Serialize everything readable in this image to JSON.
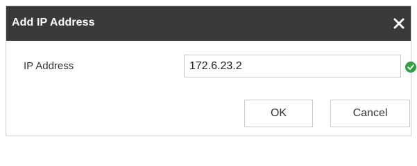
{
  "dialog": {
    "title": "Add IP Address",
    "close_icon": "close-icon"
  },
  "form": {
    "ip_label": "IP Address",
    "ip_value": "172.6.23.2",
    "valid_icon": "check-circle-icon",
    "valid_color": "#2ea043"
  },
  "buttons": {
    "ok_label": "OK",
    "cancel_label": "Cancel"
  },
  "colors": {
    "titlebar": "#3a3a3a",
    "title_text": "#ffffff"
  }
}
